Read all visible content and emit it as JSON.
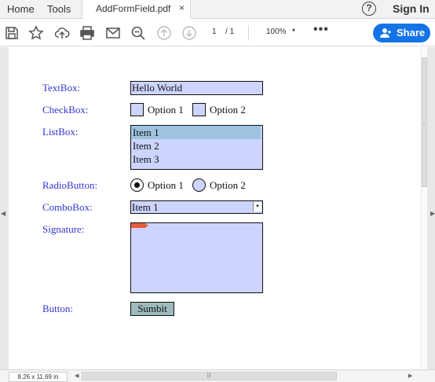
{
  "menubar": {
    "home": "Home",
    "tools": "Tools",
    "tab_title": "AddFormField.pdf",
    "tab_close": "×",
    "help": "?",
    "sign_in": "Sign In"
  },
  "toolbar": {
    "icons": [
      "save-icon",
      "bookmark-star-icon",
      "upload-cloud-icon",
      "print-icon",
      "email-icon",
      "zoom-search-icon",
      "page-up-icon",
      "page-down-icon"
    ],
    "page_current": "1",
    "page_total": "/ 1",
    "zoom": "100%",
    "zoom_caret": "▾",
    "more": "•••",
    "share_label": "Share",
    "share_color": "#1473e6"
  },
  "form": {
    "textbox_label": "TextBox:",
    "textbox_value": "Hello World",
    "checkbox_label": "CheckBox:",
    "checkbox_options": [
      "Option 1",
      "Option 2"
    ],
    "listbox_label": "ListBox:",
    "listbox_items": [
      "Item 1",
      "Item 2",
      "Item 3"
    ],
    "listbox_selected": "Item 1",
    "radio_label": "RadioButton:",
    "radio_options": [
      "Option 1",
      "Option 2"
    ],
    "radio_selected": "Option 1",
    "combobox_label": "ComboBox:",
    "combobox_value": "Item 1",
    "signature_label": "Signature:",
    "button_label": "Button:",
    "button_text": "Sumbit",
    "label_color": "#3434d1",
    "field_color": "#cdd5ff"
  },
  "status": {
    "page_size": "8.26 x 11.69 in"
  }
}
